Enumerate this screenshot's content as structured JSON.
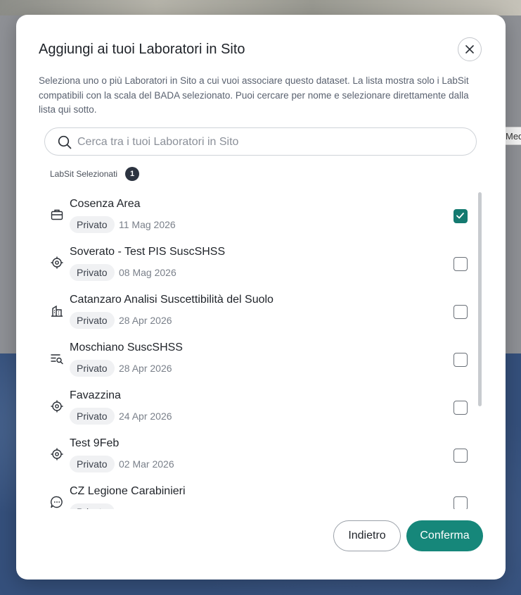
{
  "backdrop": {
    "chip_label": "Med"
  },
  "dialog": {
    "title": "Aggiungi ai tuoi Laboratori in Sito",
    "description": "Seleziona uno o più Laboratori in Sito a cui vuoi associare questo dataset. La lista mostra solo i LabSit compatibili con la scala del BADA selezionato. Puoi cercare per nome e selezionare direttamente dalla lista qui sotto.",
    "search": {
      "placeholder": "Cerca tra i tuoi Laboratori in Sito",
      "value": ""
    },
    "selected": {
      "label": "LabSit Selezionati",
      "count": "1"
    },
    "items": [
      {
        "name": "Cosenza Area",
        "tag": "Privato",
        "date": "11 Mag 2026",
        "icon": "briefcase-icon",
        "checked": true
      },
      {
        "name": "Soverato - Test PIS SuscSHSS",
        "tag": "Privato",
        "date": "08 Mag 2026",
        "icon": "target-icon",
        "checked": false
      },
      {
        "name": "Catanzaro Analisi Suscettibilità del Suolo",
        "tag": "Privato",
        "date": "28 Apr 2026",
        "icon": "building-icon",
        "checked": false
      },
      {
        "name": "Moschiano SuscSHSS",
        "tag": "Privato",
        "date": "28 Apr 2026",
        "icon": "list-search-icon",
        "checked": false
      },
      {
        "name": "Favazzina",
        "tag": "Privato",
        "date": "24 Apr 2026",
        "icon": "target-icon",
        "checked": false
      },
      {
        "name": "Test 9Feb",
        "tag": "Privato",
        "date": "02 Mar 2026",
        "icon": "target-icon",
        "checked": false
      },
      {
        "name": "CZ Legione Carabinieri",
        "tag": "Privato",
        "date": "",
        "icon": "chat-icon",
        "checked": false
      }
    ],
    "buttons": {
      "back": "Indietro",
      "confirm": "Conferma"
    }
  },
  "colors": {
    "accent": "#16877a",
    "checkbox_on": "#147a70",
    "badge": "#2c3340"
  }
}
